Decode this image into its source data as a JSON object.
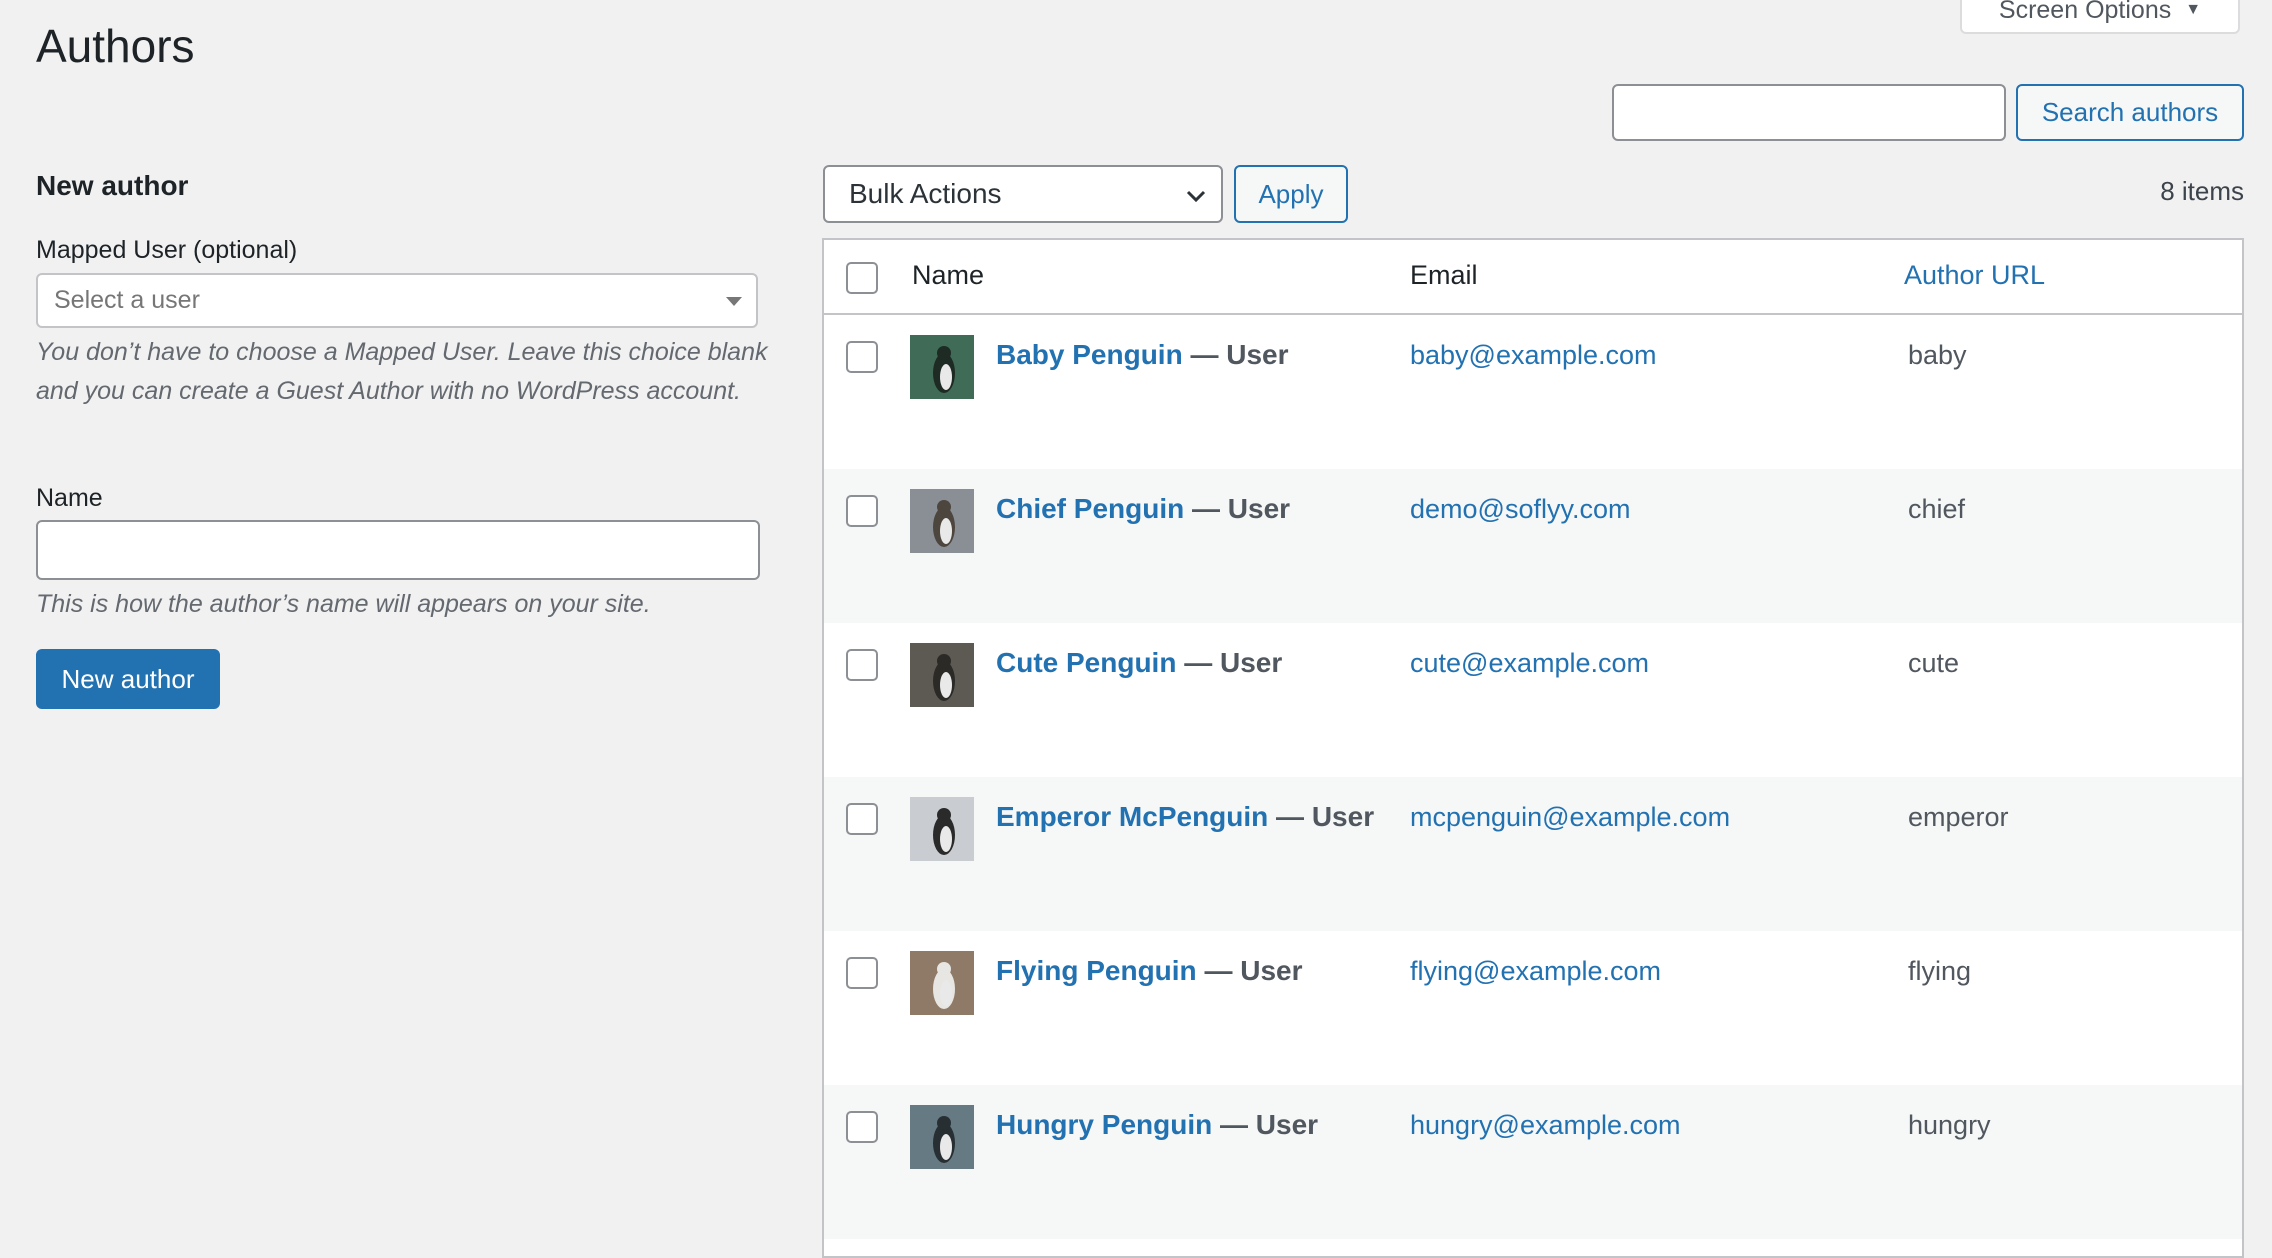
{
  "page": {
    "title": "Authors",
    "screen_options": "Screen Options"
  },
  "search": {
    "placeholder": "",
    "button": "Search authors"
  },
  "form": {
    "heading": "New author",
    "mapped_user_label": "Mapped User (optional)",
    "mapped_user_placeholder": "Select a user",
    "mapped_user_help": "You don’t have to choose a Mapped User. Leave this choice blank and you can create a Guest Author with no WordPress account.",
    "name_label": "Name",
    "name_value": "",
    "name_help": "This is how the author’s name will appears on your site.",
    "submit": "New author"
  },
  "tablenav": {
    "bulk_actions": "Bulk Actions",
    "apply": "Apply",
    "items_count": "8 items"
  },
  "table": {
    "columns": {
      "name": "Name",
      "email": "Email",
      "author_url": "Author URL"
    },
    "rows": [
      {
        "name": "Baby Penguin",
        "role": "— User",
        "email": "baby@example.com",
        "url": "baby",
        "avatar_colors": [
          "#3f6b57",
          "#1e2a24"
        ]
      },
      {
        "name": "Chief Penguin",
        "role": "— User",
        "email": "demo@soflyy.com",
        "url": "chief",
        "avatar_colors": [
          "#8a8f96",
          "#4d463e"
        ]
      },
      {
        "name": "Cute Penguin",
        "role": "— User",
        "email": "cute@example.com",
        "url": "cute",
        "avatar_colors": [
          "#5d5a53",
          "#2b2a27"
        ]
      },
      {
        "name": "Emperor McPenguin",
        "role": "— User",
        "email": "mcpenguin@example.com",
        "url": "emperor",
        "avatar_colors": [
          "#c9ccd0",
          "#2a2a2a"
        ]
      },
      {
        "name": "Flying Penguin",
        "role": "— User",
        "email": "flying@example.com",
        "url": "flying",
        "avatar_colors": [
          "#8e7a66",
          "#e8e6e2"
        ]
      },
      {
        "name": "Hungry Penguin",
        "role": "— User",
        "email": "hungry@example.com",
        "url": "hungry",
        "avatar_colors": [
          "#667a84",
          "#272f33"
        ]
      }
    ]
  },
  "colors": {
    "accent": "#2271b1",
    "background": "#f1f1f1",
    "row_alt": "#f6f7f7"
  }
}
